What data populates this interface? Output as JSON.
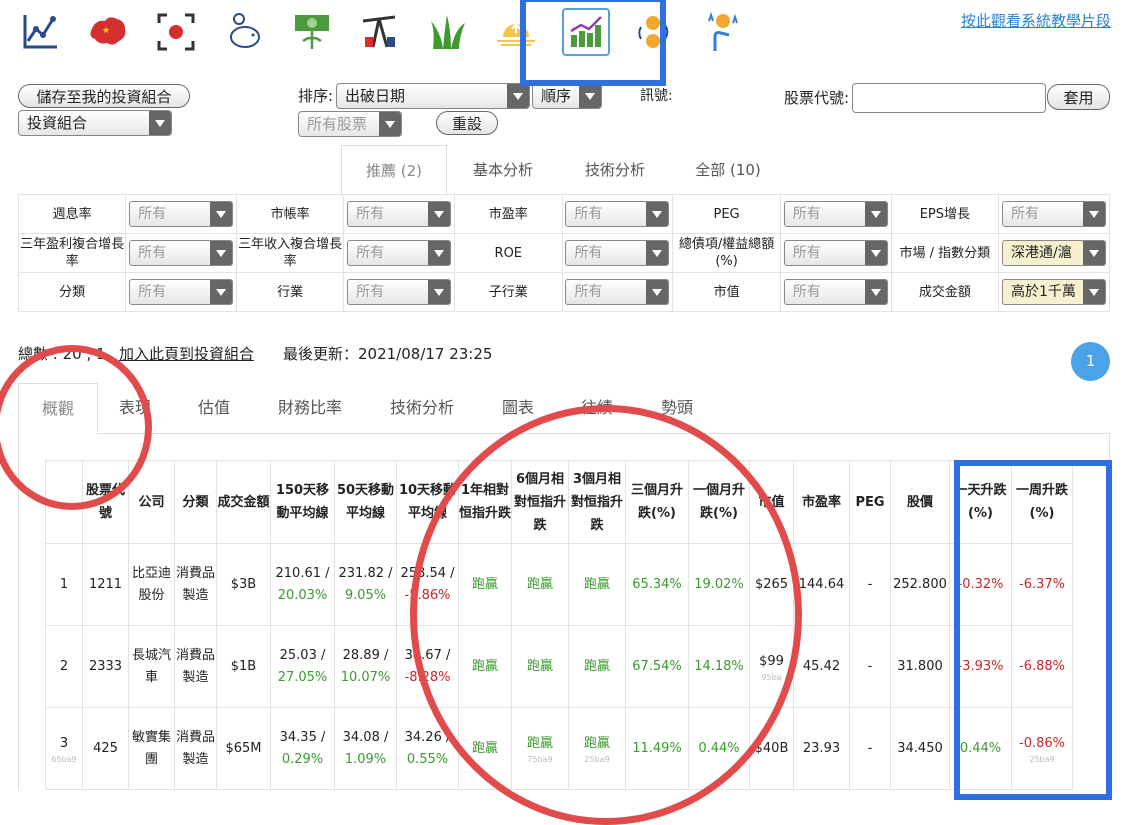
{
  "header": {
    "icons": [
      "line-chart-icon",
      "china-map-icon",
      "record-icon",
      "piggy-bank-icon",
      "money-growth-icon",
      "oil-pump-icon",
      "grass-icon",
      "sunrise-icon",
      "bar-growth-icon",
      "coin-exchange-icon",
      "coin-tap-icon"
    ],
    "tutorial_link": "按此觀看系統教學片段"
  },
  "toolbar": {
    "save_portfolio": "儲存至我的投資組合",
    "portfolio_select": "投資組合",
    "sort_label": "排序:",
    "sort_value": "出破日期",
    "order_value": "順序",
    "signal_label": "訊號:",
    "stock_filter": "所有股票",
    "reset": "重設",
    "stock_code_label": "股票代號:",
    "stock_code_value": "",
    "apply": "套用"
  },
  "filter_tabs": [
    "推薦 (2)",
    "基本分析",
    "技術分析",
    "全部 (10)"
  ],
  "filters": {
    "rows": [
      [
        {
          "label": "週息率",
          "value": "所有"
        },
        {
          "label": "市帳率",
          "value": "所有"
        },
        {
          "label": "市盈率",
          "value": "所有"
        },
        {
          "label": "PEG",
          "value": "所有"
        },
        {
          "label": "EPS增長",
          "value": "所有"
        }
      ],
      [
        {
          "label": "三年盈利複合增長率",
          "value": "所有"
        },
        {
          "label": "三年收入複合增長率",
          "value": "所有"
        },
        {
          "label": "ROE",
          "value": "所有"
        },
        {
          "label": "總債項/權益總額 (%)",
          "value": "所有"
        },
        {
          "label": "市場 / 指數分類",
          "value": "深港通/滬"
        }
      ],
      [
        {
          "label": "分類",
          "value": "所有"
        },
        {
          "label": "行業",
          "value": "所有"
        },
        {
          "label": "子行業",
          "value": "所有"
        },
        {
          "label": "市值",
          "value": "所有"
        },
        {
          "label": "成交金額",
          "value": "高於1千萬"
        }
      ]
    ]
  },
  "summary": {
    "total": "總數 : 20 , 1",
    "add_page": "加入此頁到投資組合",
    "last_update": "最後更新：2021/08/17 23:25",
    "page": "1"
  },
  "result_tabs": [
    "概觀",
    "表現",
    "估值",
    "財務比率",
    "技術分析",
    "圖表",
    "往績",
    "勢頭"
  ],
  "table": {
    "headers": [
      "",
      "股票代號",
      "公司",
      "分類",
      "成交金額",
      "150天移動平均線",
      "50天移動平均線",
      "10天移動平均線",
      "1年相對恒指升跌",
      "6個月相對恒指升跌",
      "3個月相對恒指升跌",
      "三個月升跌(%)",
      "一個月升跌(%)",
      "市值",
      "市盈率",
      "PEG",
      "股價",
      "一天升跌(%)",
      "一周升跌(%)"
    ],
    "rows": [
      {
        "idx": "1",
        "idx_sub": "",
        "code": "1211",
        "company": "比亞迪股份",
        "category": "消費品製造",
        "turnover": "$3B",
        "ma150": "210.61 /",
        "ma150p": "20.03%",
        "ma50": "231.82 /",
        "ma50p": "9.05%",
        "ma10": "258.54 /",
        "ma10p": "-5.86%",
        "rel1y": "跑贏",
        "rel6m": "跑贏",
        "rel6m_sub": "",
        "rel3m": "跑贏",
        "rel3m_sub": "",
        "chg3m": "65.34%",
        "chg1m": "19.02%",
        "mcap": "$265",
        "mcap_sub": "",
        "pe": "144.64",
        "peg": "-",
        "price": "252.800",
        "chg1d": "-0.32%",
        "chg1w": "-6.37%",
        "chg1w_sub": ""
      },
      {
        "idx": "2",
        "idx_sub": "",
        "code": "2333",
        "company": "長城汽車",
        "category": "消費品製造",
        "turnover": "$1B",
        "ma150": "25.03 /",
        "ma150p": "27.05%",
        "ma50": "28.89 /",
        "ma50p": "10.07%",
        "ma10": "34.67 /",
        "ma10p": "-8.28%",
        "rel1y": "跑贏",
        "rel6m": "跑贏",
        "rel6m_sub": "",
        "rel3m": "跑贏",
        "rel3m_sub": "",
        "chg3m": "67.54%",
        "chg1m": "14.18%",
        "mcap": "$99",
        "mcap_sub": "95ba",
        "pe": "45.42",
        "peg": "-",
        "price": "31.800",
        "chg1d": "-3.93%",
        "chg1w": "-6.88%",
        "chg1w_sub": ""
      },
      {
        "idx": "3",
        "idx_sub": "65ba9",
        "code": "425",
        "company": "敏實集團",
        "category": "消費品製造",
        "turnover": "$65M",
        "ma150": "34.35 /",
        "ma150p": "0.29%",
        "ma50": "34.08 /",
        "ma50p": "1.09%",
        "ma10": "34.26 /",
        "ma10p": "0.55%",
        "rel1y": "跑贏",
        "rel6m": "跑贏",
        "rel6m_sub": "75ba9",
        "rel3m": "跑贏",
        "rel3m_sub": "25ba9",
        "chg3m": "11.49%",
        "chg1m": "0.44%",
        "mcap": "$40B",
        "mcap_sub": "",
        "pe": "23.93",
        "peg": "-",
        "price": "34.450",
        "chg1d": "0.44%",
        "chg1w": "-0.86%",
        "chg1w_sub": "25ba9"
      }
    ]
  },
  "colors": {
    "accent": "#2a7fd4",
    "positive": "#3a9a2e",
    "negative": "#c62828",
    "highlight_box": "#2f6fe0",
    "highlight_circle": "#e14b4b"
  }
}
